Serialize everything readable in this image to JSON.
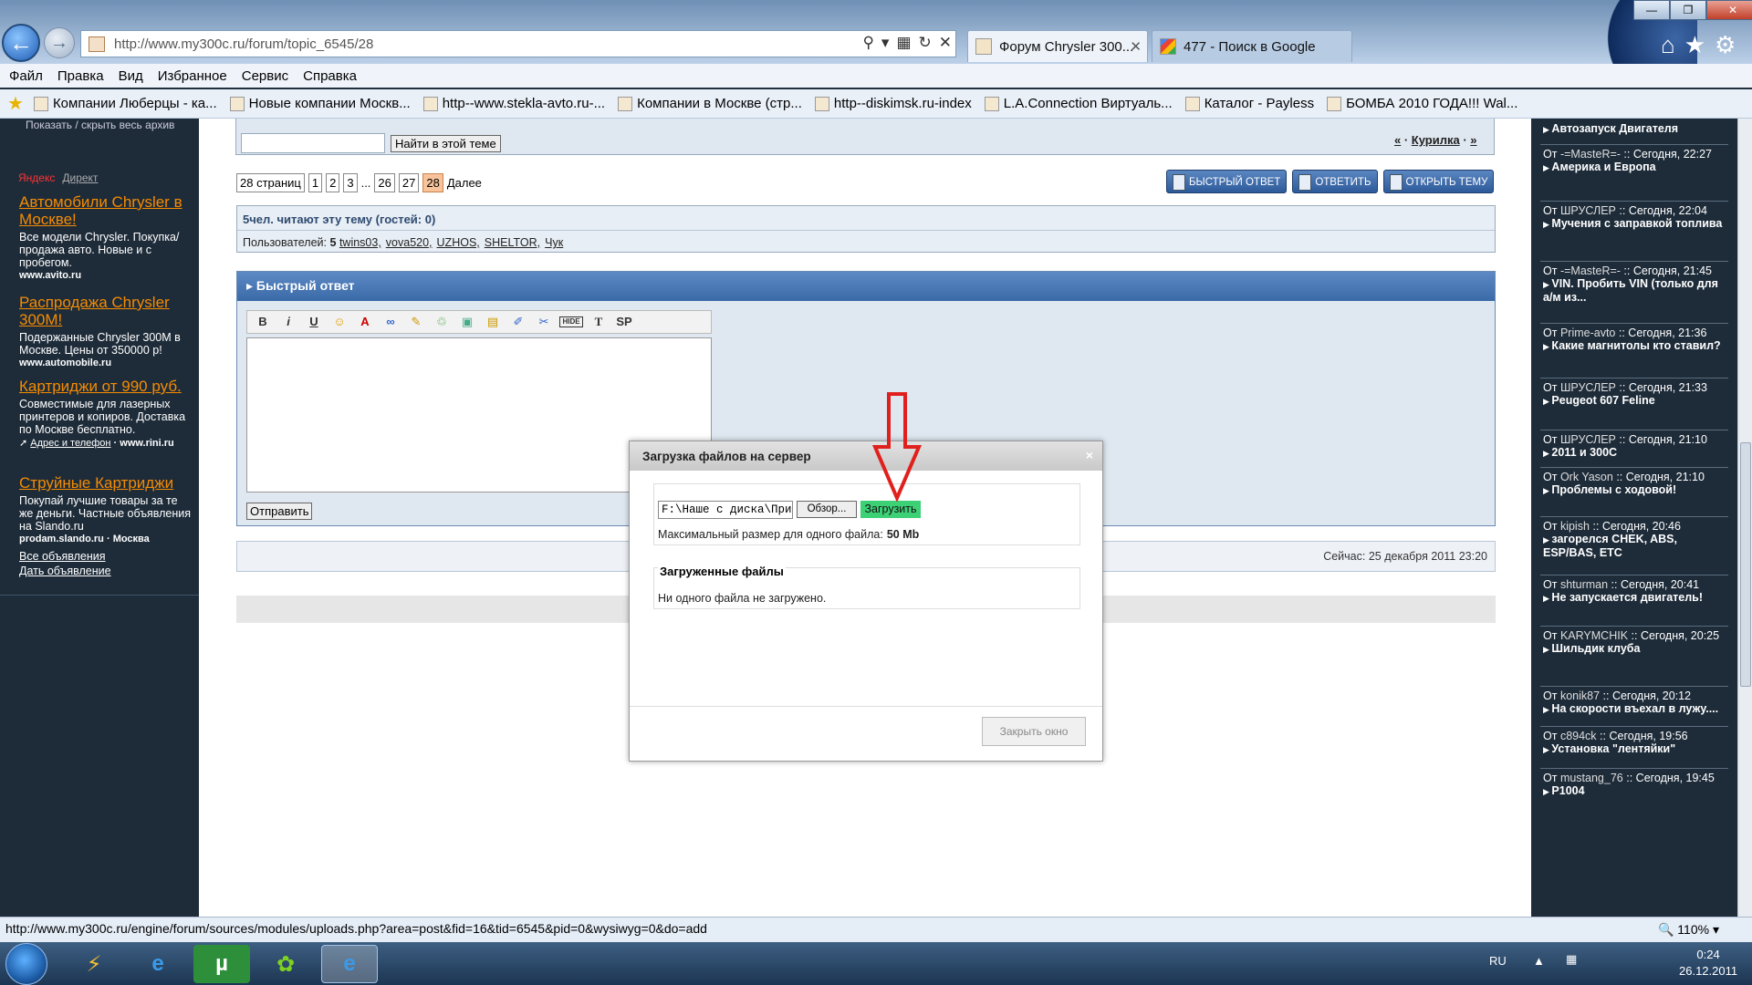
{
  "browser": {
    "url": "http://www.my300c.ru/forum/topic_6545/28",
    "tabs": [
      {
        "label": "Форум Chrysler 300..."
      },
      {
        "label": "477 - Поиск в Google"
      }
    ],
    "menu": [
      "Файл",
      "Правка",
      "Вид",
      "Избранное",
      "Сервис",
      "Справка"
    ],
    "favorites": [
      "Компании Люберцы - ка...",
      "Новые компании Москв...",
      "http--www.stekla-avto.ru-...",
      "Компании в Москве (стр...",
      "http--diskimsk.ru-index",
      "L.A.Connection Виртуаль...",
      "Каталог - Payless",
      "БОМБА 2010 ГОДА!!! Wal..."
    ],
    "status_url": "http://www.my300c.ru/engine/forum/sources/modules/uploads.php?area=post&fid=16&tid=6545&pid=0&wysiwyg=0&do=add",
    "zoom": "110%"
  },
  "sidebar_left": {
    "archive_link": "Показать / скрыть весь архив",
    "yandex": "Яндекс",
    "direct": "Директ",
    "ads": [
      {
        "title": "Автомобили Chrysler в Москве!",
        "body": "Все модели Chrysler. Покупка/продажа авто. Новые и с пробегом.",
        "url": "www.avito.ru"
      },
      {
        "title": "Распродажа Chrysler 300M!",
        "body": "Подержанные Chrysler 300М в Москве. Цены от 350000 р!",
        "url": "www.automobile.ru"
      },
      {
        "title": "Картриджи от 990 руб.",
        "body": "Совместимые для лазерных принтеров и копиров. Доставка по Москве бесплатно.",
        "url": "www.rini.ru",
        "extra": "Адрес и телефон"
      },
      {
        "title": "Струйные Картриджи",
        "body": "Покупай лучшие товары за те же деньги. Частные объявления на Slando.ru",
        "url": "prodam.slando.ru",
        "extra": "Москва"
      }
    ],
    "all_ads": "Все объявления",
    "post_ad": "Дать объявление"
  },
  "forum": {
    "search_button": "Найти в этой теме",
    "nav_prev": "«",
    "nav_section": "Курилка",
    "nav_next": "»",
    "pager": {
      "label": "28 страниц",
      "pages": [
        "1",
        "2",
        "3",
        "...",
        "26",
        "27",
        "28"
      ],
      "current": "28",
      "next": "Далее"
    },
    "buttons": {
      "quick_reply": "БЫСТРЫЙ ОТВЕТ",
      "reply": "ОТВЕТИТЬ",
      "new_topic": "ОТКРЫТЬ ТЕМУ"
    },
    "readers_title": "5чел. читают эту тему (гостей: 0)",
    "users_label": "Пользователей:",
    "users_count": "5",
    "users": [
      "twins03,",
      "vova520,",
      "UZHOS,",
      "SHELTOR,",
      "Чук"
    ],
    "quick_reply_title": "Быстрый ответ",
    "editor_buttons": [
      "B",
      "i",
      "U",
      "☺",
      "A",
      "∞",
      "✎",
      "♲",
      "▣",
      "▤",
      "✐",
      "✂",
      "HIDE",
      "T",
      "SP"
    ],
    "send_button": "Отправить",
    "now_text": "Сейчас: 25 декабря 2011 23:20"
  },
  "dialog": {
    "title": "Загрузка файлов на сервер",
    "close_x": "×",
    "file_path": "F:\\Наше с диска\\Прикс",
    "browse": "Обзор...",
    "upload": "Загрузить",
    "max_size_label": "Максимальный размер для одного файла:",
    "max_size_value": "50 Mb",
    "uploaded_title": "Загруженные файлы",
    "no_files": "Ни одного файла не загружено.",
    "close_window": "Закрыть окно"
  },
  "sidebar_right": {
    "items": [
      {
        "from": "",
        "time": "",
        "topic": "Автозапуск Двигателя"
      },
      {
        "from": "-=MasteR=-",
        "time": "Сегодня, 22:27",
        "topic": "Америка и Европа"
      },
      {
        "from": "ШРУСЛЕР",
        "time": "Сегодня, 22:04",
        "topic": "Мучения с заправкой топлива"
      },
      {
        "from": "-=MasteR=-",
        "time": "Сегодня, 21:45",
        "topic": "VIN. Пробить VIN (только для а/м из..."
      },
      {
        "from": "Prime-avto",
        "time": "Сегодня, 21:36",
        "topic": "Какие магнитолы кто ставил?"
      },
      {
        "from": "ШРУСЛЕР",
        "time": "Сегодня, 21:33",
        "topic": "Peugeot 607 Feline"
      },
      {
        "from": "ШРУСЛЕР",
        "time": "Сегодня, 21:10",
        "topic": "2011 и 300C"
      },
      {
        "from": "Ork Yason",
        "time": "Сегодня, 21:10",
        "topic": "Проблемы с ходовой!"
      },
      {
        "from": "kipish",
        "time": "Сегодня, 20:46",
        "topic": "загорелся CHEK, ABS, ESP/BAS, ETC"
      },
      {
        "from": "shturman",
        "time": "Сегодня, 20:41",
        "topic": "Не запускается двигатель!"
      },
      {
        "from": "KARYMCHIK",
        "time": "Сегодня, 20:25",
        "topic": "Шильдик клуба"
      },
      {
        "from": "konik87",
        "time": "Сегодня, 20:12",
        "topic": "На скорости въехал в лужу...."
      },
      {
        "from": "c894ck",
        "time": "Сегодня, 19:56",
        "topic": "Установка \"лентяйки\""
      },
      {
        "from": "mustang_76",
        "time": "Сегодня, 19:45",
        "topic": "P1004"
      }
    ],
    "from_label": "От",
    "sep": "::"
  },
  "taskbar": {
    "lang": "RU",
    "time": "0:24",
    "date": "26.12.2011"
  }
}
